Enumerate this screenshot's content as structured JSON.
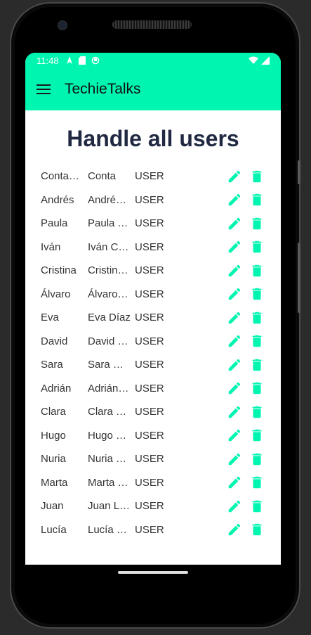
{
  "status_bar": {
    "time": "11:48",
    "left_icons": [
      "navigation-icon",
      "sim-card-icon",
      "sync-icon"
    ],
    "right_icons": [
      "wifi-icon",
      "signal-icon"
    ]
  },
  "app_bar": {
    "title": "TechieTalks",
    "menu_icon": "hamburger-menu-icon"
  },
  "page": {
    "title": "Handle all users"
  },
  "colors": {
    "accent": "#00f5b0",
    "title": "#212842",
    "icon": "#00f5b0"
  },
  "users": [
    {
      "username": "ContaP…",
      "name": "Conta",
      "role": "USER"
    },
    {
      "username": "Andrés",
      "name": "Andrés…",
      "role": "USER"
    },
    {
      "username": "Paula",
      "name": "Paula T…",
      "role": "USER"
    },
    {
      "username": "Iván",
      "name": "Iván Ca…",
      "role": "USER"
    },
    {
      "username": "Cristina",
      "name": "Cristina…",
      "role": "USER"
    },
    {
      "username": "Álvaro",
      "name": "Álvaro…",
      "role": "USER"
    },
    {
      "username": "Eva",
      "name": "Eva Díaz",
      "role": "USER"
    },
    {
      "username": "David",
      "name": "David S…",
      "role": "USER"
    },
    {
      "username": "Sara",
      "name": "Sara Gó…",
      "role": "USER"
    },
    {
      "username": "Adrián",
      "name": "Adrián…",
      "role": "USER"
    },
    {
      "username": "Clara",
      "name": "Clara Ji…",
      "role": "USER"
    },
    {
      "username": "Hugo",
      "name": "Hugo F…",
      "role": "USER"
    },
    {
      "username": "Nuria",
      "name": "Nuria H…",
      "role": "USER"
    },
    {
      "username": "Marta",
      "name": "Marta G…",
      "role": "USER"
    },
    {
      "username": "Juan",
      "name": "Juan Ló…",
      "role": "USER"
    },
    {
      "username": "Lucía",
      "name": "Lucía P…",
      "role": "USER"
    }
  ],
  "row_actions": {
    "edit_icon": "pencil-edit-icon",
    "delete_icon": "trash-delete-icon"
  }
}
